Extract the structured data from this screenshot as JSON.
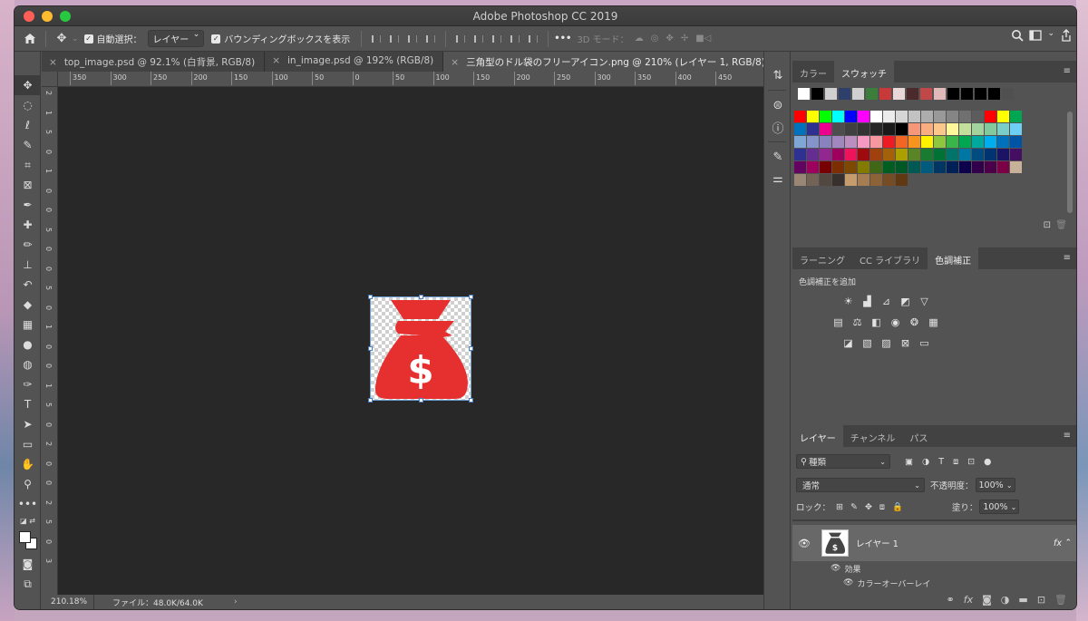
{
  "window": {
    "title": "Adobe Photoshop CC 2019"
  },
  "options_bar": {
    "auto_select_label": "自動選択：",
    "auto_select_value": "レイヤー",
    "bounding_box_label": "バウンディングボックスを表示",
    "more_label": "•••",
    "mode_3d_label": "3D モード："
  },
  "tabs": [
    {
      "label": "top_image.psd @ 92.1% (白背景, RGB/8)"
    },
    {
      "label": "in_image.psd @ 192% (RGB/8)"
    },
    {
      "label": "三角型のドル袋のフリーアイコン.png @ 210% (レイヤー 1, RGB/8) *"
    }
  ],
  "ruler_h": [
    "350",
    "300",
    "250",
    "200",
    "150",
    "100",
    "50",
    "0",
    "50",
    "100",
    "150",
    "200",
    "250",
    "300",
    "350",
    "400",
    "450"
  ],
  "ruler_v": [
    "2",
    "1",
    "5",
    "0",
    "1",
    "0",
    "0",
    "5",
    "0",
    "0",
    "5",
    "0",
    "1",
    "0",
    "0",
    "1",
    "5",
    "0",
    "2",
    "0",
    "0",
    "2",
    "5",
    "0",
    "3"
  ],
  "status": {
    "zoom": "210.18%",
    "file_info": "ファイル：48.0K/64.0K"
  },
  "swatches_panel": {
    "tabs": [
      "カラー",
      "スウォッチ"
    ],
    "recent": [
      "#ffffff",
      "#000000",
      "#d0d0d0",
      "#2f3f6c",
      "#d0d0d0",
      "#3c7d3c",
      "#c83a3a",
      "#e8d8d8",
      "#4a2a2a",
      "#c04848",
      "#e0b8b8",
      "#000000",
      "#000000",
      "#000000",
      "#000000",
      "#505050"
    ],
    "grid": [
      [
        "#ff0000",
        "#ffff00",
        "#00ff00",
        "#00ffff",
        "#0000ff",
        "#ff00ff",
        "#ffffff",
        "#ebebeb",
        "#d6d6d6",
        "#c2c2c2",
        "#adadad",
        "#999999",
        "#858585",
        "#707070",
        "#5c5c5c",
        "#ff0000",
        "#ffff00",
        "#00a651"
      ],
      [
        "#0072bc",
        "#2e3192",
        "#ec008c",
        "#4d4d4d",
        "#404040",
        "#333333",
        "#262626",
        "#1a1a1a",
        "#000000",
        "#f7977a",
        "#f9ad81",
        "#fdc68a",
        "#fff79a",
        "#c4df9b",
        "#a3d39c",
        "#82ca9d",
        "#7bcdc8",
        "#6ecff6"
      ],
      [
        "#7ea7d8",
        "#8493ca",
        "#8882be",
        "#a187be",
        "#bc8dbf",
        "#f49ac2",
        "#f6989d",
        "#ed1c24",
        "#f26522",
        "#f7941d",
        "#fff200",
        "#8dc63f",
        "#39b54a",
        "#00a651",
        "#00a99d",
        "#00aeef",
        "#0072bc",
        "#0054a6"
      ],
      [
        "#2e3192",
        "#662d91",
        "#92278f",
        "#9e005d",
        "#ed145b",
        "#9e0b0f",
        "#a0410d",
        "#a3620a",
        "#aba000",
        "#598527",
        "#197b30",
        "#007236",
        "#00746b",
        "#0076a3",
        "#004b80",
        "#003471",
        "#1b1464",
        "#440e62"
      ],
      [
        "#630460",
        "#9e005d",
        "#790000",
        "#7b2e00",
        "#7d4900",
        "#827b00",
        "#406618",
        "#005e20",
        "#005826",
        "#005952",
        "#005b7f",
        "#003663",
        "#002157",
        "#0d004c",
        "#32004b",
        "#4b0049",
        "#7b0046",
        "#c7b299"
      ],
      [
        "#998675",
        "#736357",
        "#534741",
        "#37302d",
        "#c69c6d",
        "#a67c52",
        "#8c6239",
        "#754c24",
        "#603913"
      ]
    ]
  },
  "adjustments_panel": {
    "tabs": [
      "ラーニング",
      "CC ライブラリ",
      "色調補正"
    ],
    "title": "色調補正を追加"
  },
  "layers_panel": {
    "tabs": [
      "レイヤー",
      "チャンネル",
      "パス"
    ],
    "filter_label": "種類",
    "blend_mode": "通常",
    "opacity_label": "不透明度：",
    "opacity_value": "100%",
    "lock_label": "ロック：",
    "fill_label": "塗り：",
    "fill_value": "100%",
    "layer_name": "レイヤー 1",
    "fx_label": "fx",
    "effects_label": "効果",
    "effect_name": "カラーオーバーレイ"
  },
  "colors": {
    "accent_red": "#e63030",
    "selection_blue": "#4a7fc1"
  }
}
